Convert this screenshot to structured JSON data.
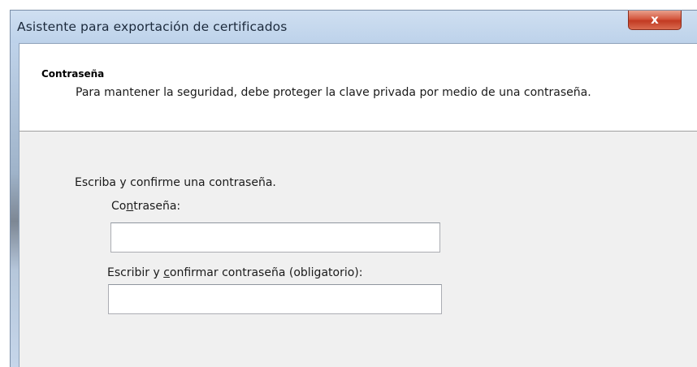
{
  "window": {
    "title": "Asistente para exportación de certificados",
    "close_glyph": "x"
  },
  "header": {
    "section_title": "Contraseña",
    "description": "Para mantener la seguridad, debe proteger la clave privada por medio de una contraseña."
  },
  "form": {
    "instruction": "Escriba y confirme una contraseña.",
    "password": {
      "label_before": "Co",
      "label_mnemonic": "n",
      "label_after": "traseña:",
      "value": ""
    },
    "confirm": {
      "label_before": "Escribir y ",
      "label_mnemonic": "c",
      "label_after": "onfirmar contraseña (obligatorio):",
      "value": ""
    }
  },
  "colors": {
    "titlebar": "#bdd2ea",
    "close_button": "#c23a22",
    "content_background": "#f0f0f0"
  },
  "icons": [
    "close-icon"
  ]
}
